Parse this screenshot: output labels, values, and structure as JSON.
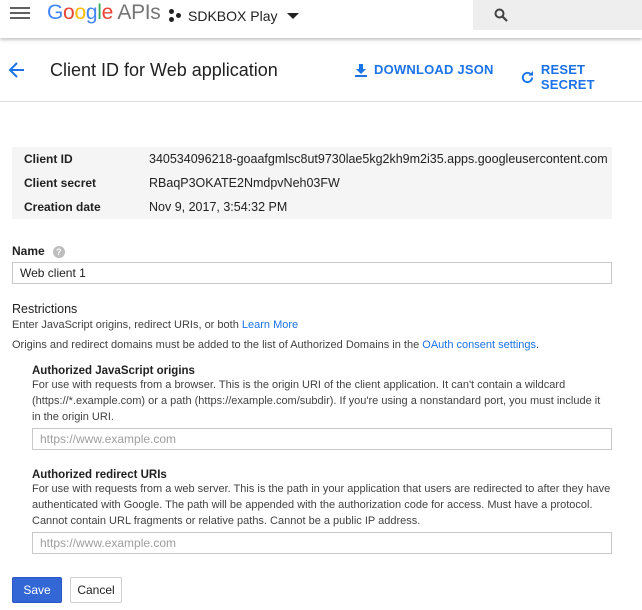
{
  "topbar": {
    "logo_google": [
      "G",
      "o",
      "o",
      "g",
      "l",
      "e"
    ],
    "logo_apis": " APIs",
    "project_name": "SDKBOX Play",
    "icons": {
      "menu": "hamburger-icon",
      "project": "project-icon",
      "dropdown": "caret-down-icon",
      "search": "search-icon"
    }
  },
  "header": {
    "title": "Client ID for Web application",
    "download_label": "DOWNLOAD JSON",
    "reset_label": "RESET SECRET",
    "accent": "#1a73e8"
  },
  "info": {
    "rows": [
      {
        "key": "Client ID",
        "value": "340534096218-goaafgmlsc8ut9730lae5kg2kh9m2i35.apps.googleusercontent.com"
      },
      {
        "key": "Client secret",
        "value": "RBaqP3OKATE2NmdpvNeh03FW"
      },
      {
        "key": "Creation date",
        "value": "Nov 9, 2017, 3:54:32 PM"
      }
    ]
  },
  "form": {
    "name_label": "Name",
    "name_value": "Web client 1",
    "restrictions_title": "Restrictions",
    "restrictions_text": "Enter JavaScript origins, redirect URIs, or both ",
    "learn_more": "Learn More",
    "domains_text": "Origins and redirect domains must be added to the list of Authorized Domains in the ",
    "consent_link": "OAuth consent settings",
    "domains_end": ".",
    "js_origins": {
      "title": "Authorized JavaScript origins",
      "line1": "For use with requests from a browser. This is the origin URI of the client application. It can't contain a wildcard",
      "line2": "(https://*.example.com) or a path (https://example.com/subdir). If you're using a nonstandard port, you must include it",
      "line3": "in the origin URI.",
      "placeholder": "https://www.example.com"
    },
    "redirect_uris": {
      "title": "Authorized redirect URIs",
      "line1": "For use with requests from a web server. This is the path in your application that users are redirected to after they have",
      "line2": "authenticated with Google. The path will be appended with the authorization code for access. Must have a protocol.",
      "line3": "Cannot contain URL fragments or relative paths. Cannot be a public IP address.",
      "placeholder": "https://www.example.com"
    },
    "save_label": "Save",
    "cancel_label": "Cancel",
    "primary_color": "#3367d6"
  }
}
